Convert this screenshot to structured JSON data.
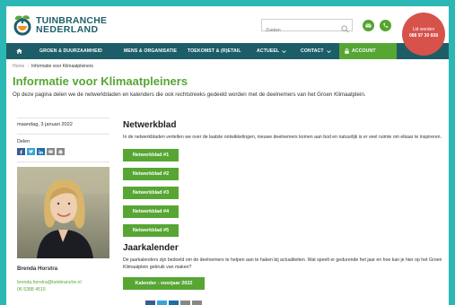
{
  "brand": {
    "line1": "TUINBRANCHE",
    "line2": "NEDERLAND",
    "orange": "#f29222",
    "teal": "#1e5f6b"
  },
  "search": {
    "placeholder": "Zoeken"
  },
  "member": {
    "label": "Lid worden",
    "phone": "088 97 30 608",
    "color": "#d6524b"
  },
  "nav": {
    "items": [
      {
        "label": "GROEN & DUURZAAMHEID"
      },
      {
        "label": "MENS & ORGANISATIE"
      },
      {
        "label": "TOEKOMST & (R)ETAIL"
      },
      {
        "label": "ACTUEEL"
      },
      {
        "label": "CONTACT"
      }
    ],
    "account": "ACCOUNT",
    "color": "#1d5d68"
  },
  "breadcrumb": {
    "home": "Home",
    "current": "Informatie voor Klimaatpleiners"
  },
  "page": {
    "title": "Informatie voor Klimaatpleiners",
    "intro": "Op deze pagina delen we de netwerkbladen en kalenders die ook rechtstreeks gedeeld worden met de deelnemers van het Groen Klimaatplein."
  },
  "sidebar": {
    "date": "maandag, 3 januari 2022",
    "share": "Delen",
    "name": "Brenda Horstra",
    "email": "brenda.horstra@tuinbranche.nl",
    "phone": "06 5388 4515"
  },
  "main": {
    "netwerkblad_title": "Netwerkblad",
    "netwerkblad_text": "In de netwerkbladen vertellen we over de laatste ontwikkelingen, nieuwe deelnemers komen aan bod en natuurlijk is er veel ruimte om elkaar te inspireren.",
    "buttons": [
      "Netwerkblad #1",
      "Netwerkblad #2",
      "Netwerkblad #3",
      "Netwerkblad #4",
      "Netwerkblad #5"
    ],
    "jaarkalender_title": "Jaarkalender",
    "jaarkalender_text": "De jaarkalenders zijn bedoeld om de deelnemers te helpen aan te haken bij actualiteiten. Wat speelt er gedurende het jaar en hoe kan je hier op het Groen Klimaatplein gebruik van maken?",
    "kalender_button": "Kalender - voorjaar 2022"
  },
  "colors": {
    "accent": "#57a634",
    "frame": "#2bb7b3"
  }
}
